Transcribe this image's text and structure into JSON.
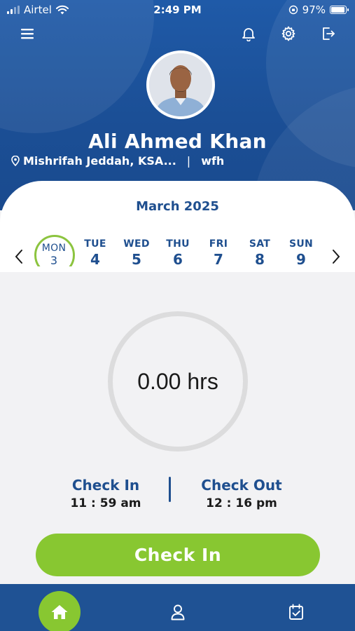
{
  "status_bar": {
    "carrier": "Airtel",
    "time": "2:49 PM",
    "battery": "97%",
    "battery_level": 0.97
  },
  "header": {
    "icons": [
      "menu-icon",
      "bell-icon",
      "gear-icon",
      "logout-icon"
    ]
  },
  "profile": {
    "name": "Ali Ahmed Khan",
    "location": "Mishrifah Jeddah, KSA...",
    "separator": "|",
    "work_mode": "wfh"
  },
  "calendar": {
    "month": "March 2025",
    "days": [
      {
        "name": "MON",
        "num": "3",
        "active": true
      },
      {
        "name": "TUE",
        "num": "4",
        "active": false
      },
      {
        "name": "WED",
        "num": "5",
        "active": false
      },
      {
        "name": "THU",
        "num": "6",
        "active": false
      },
      {
        "name": "FRI",
        "num": "7",
        "active": false
      },
      {
        "name": "SAT",
        "num": "8",
        "active": false
      },
      {
        "name": "SUN",
        "num": "9",
        "active": false
      }
    ]
  },
  "hours": {
    "value": "0.00 hrs"
  },
  "summary": {
    "check_in_label": "Check In",
    "check_in_time": "11 : 59 am",
    "check_out_label": "Check Out",
    "check_out_time": "12 : 16 pm"
  },
  "action": {
    "button_label": "Check In"
  },
  "bottom_nav": {
    "items": [
      "home-icon",
      "profile-icon",
      "calendar-check-icon"
    ],
    "active": "home-icon"
  },
  "colors": {
    "primary_blue": "#1f4f8f",
    "accent_green": "#88c731"
  }
}
